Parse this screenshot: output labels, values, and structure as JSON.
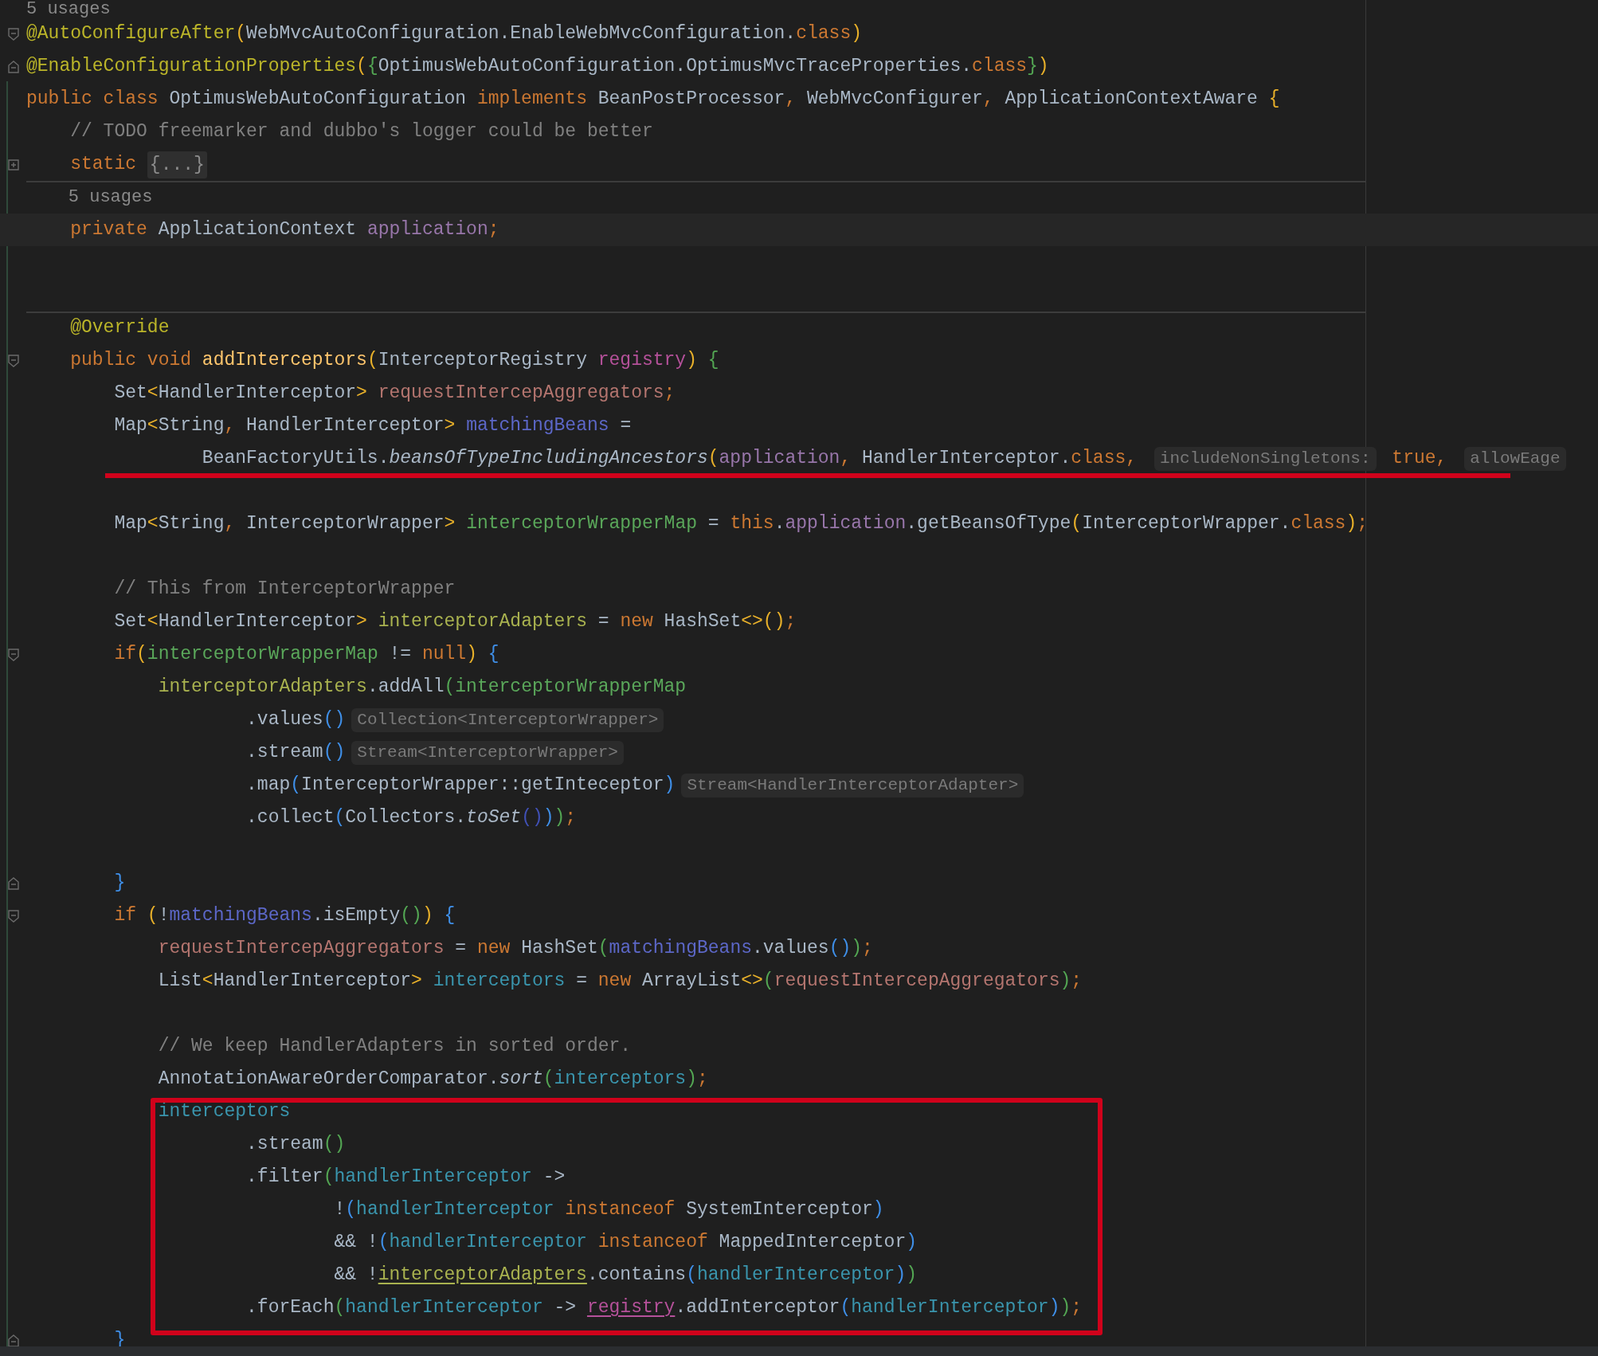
{
  "editor": {
    "lines": [
      {
        "kind": "code",
        "current": false,
        "tokens": [
          {
            "kind": "usages",
            "text": "5 usages"
          }
        ]
      },
      {
        "kind": "code",
        "current": false,
        "fold_marker": {
          "kind": "start"
        },
        "tokens": [
          {
            "kind": "annotation",
            "text": "@AutoConfigureAfter"
          },
          {
            "kind": "brace_yellow",
            "text": "("
          },
          {
            "kind": "plain",
            "text": "WebMvcAutoConfiguration.EnableWebMvcConfiguration."
          },
          {
            "kind": "keyword",
            "text": "class"
          },
          {
            "kind": "brace_yellow",
            "text": ")"
          }
        ]
      },
      {
        "kind": "code",
        "current": false,
        "fold_marker": {
          "kind": "end"
        },
        "tokens": [
          {
            "kind": "annotation",
            "text": "@EnableConfigurationProperties"
          },
          {
            "kind": "brace_yellow",
            "text": "("
          },
          {
            "kind": "brace_green",
            "text": "{"
          },
          {
            "kind": "plain",
            "text": "OptimusWebAutoConfiguration.OptimusMvcTraceProperties."
          },
          {
            "kind": "keyword",
            "text": "class"
          },
          {
            "kind": "brace_green",
            "text": "}"
          },
          {
            "kind": "brace_yellow",
            "text": ")"
          }
        ]
      },
      {
        "kind": "code",
        "current": false,
        "tokens": [
          {
            "kind": "keyword",
            "text": "public class "
          },
          {
            "kind": "plain",
            "text": "OptimusWebAutoConfiguration "
          },
          {
            "kind": "keyword",
            "text": "implements "
          },
          {
            "kind": "plain",
            "text": "BeanPostProcessor"
          },
          {
            "kind": "keyword",
            "text": ", "
          },
          {
            "kind": "plain",
            "text": "WebMvcConfigurer"
          },
          {
            "kind": "keyword",
            "text": ", "
          },
          {
            "kind": "plain",
            "text": "ApplicationContextAware "
          },
          {
            "kind": "brace_yellow",
            "text": "{"
          }
        ]
      },
      {
        "kind": "code",
        "current": false,
        "tokens": [
          {
            "kind": "comment",
            "text": "    // TODO freemarker and dubbo's logger could be better"
          }
        ]
      },
      {
        "kind": "code",
        "current": false,
        "fold_marker": {
          "kind": "collapsed"
        },
        "tokens": [
          {
            "kind": "keyword",
            "text": "    static "
          },
          {
            "kind": "folded",
            "text": "{...}"
          }
        ]
      },
      {
        "kind": "code",
        "current": false,
        "separator": true,
        "tokens": [
          {
            "kind": "usages",
            "text": "    5 usages"
          }
        ]
      },
      {
        "kind": "code",
        "current": true,
        "tokens": [
          {
            "kind": "keyword",
            "text": "    private "
          },
          {
            "kind": "plain",
            "text": "ApplicationContext "
          },
          {
            "kind": "field",
            "text": "application"
          },
          {
            "kind": "keyword",
            "text": ";"
          }
        ]
      },
      {
        "kind": "blank",
        "current": false
      },
      {
        "kind": "blank",
        "current": false
      },
      {
        "kind": "code",
        "current": false,
        "separator": true,
        "tokens": [
          {
            "kind": "annotation",
            "text": "    @Override"
          }
        ]
      },
      {
        "kind": "code",
        "current": false,
        "fold_marker": {
          "kind": "start"
        },
        "tokens": [
          {
            "kind": "keyword",
            "text": "    public void "
          },
          {
            "kind": "declaration",
            "text": "addInterceptors"
          },
          {
            "kind": "brace_yellow",
            "text": "("
          },
          {
            "kind": "plain",
            "text": "InterceptorRegistry "
          },
          {
            "kind": "parameter",
            "text": "registry"
          },
          {
            "kind": "brace_yellow",
            "text": ") "
          },
          {
            "kind": "brace_green",
            "text": "{"
          }
        ]
      },
      {
        "kind": "code",
        "current": false,
        "tokens": [
          {
            "kind": "plain",
            "text": "        Set"
          },
          {
            "kind": "brace_yellow",
            "text": "<"
          },
          {
            "kind": "plain",
            "text": "HandlerInterceptor"
          },
          {
            "kind": "brace_yellow",
            "text": "> "
          },
          {
            "kind": "var_red",
            "text": "requestIntercepAggregators"
          },
          {
            "kind": "keyword",
            "text": ";"
          }
        ]
      },
      {
        "kind": "code",
        "current": false,
        "tokens": [
          {
            "kind": "plain",
            "text": "        Map"
          },
          {
            "kind": "brace_yellow",
            "text": "<"
          },
          {
            "kind": "plain",
            "text": "String"
          },
          {
            "kind": "keyword",
            "text": ", "
          },
          {
            "kind": "plain",
            "text": "HandlerInterceptor"
          },
          {
            "kind": "brace_yellow",
            "text": "> "
          },
          {
            "kind": "var_blue",
            "text": "matchingBeans"
          },
          {
            "kind": "plain",
            "text": " ="
          }
        ]
      },
      {
        "kind": "code",
        "current": false,
        "tokens": [
          {
            "kind": "plain",
            "text": "                BeanFactoryUtils."
          },
          {
            "kind": "static_call",
            "text": "beansOfTypeIncludingAncestors"
          },
          {
            "kind": "brace_yellow",
            "text": "("
          },
          {
            "kind": "field",
            "text": "application"
          },
          {
            "kind": "keyword",
            "text": ", "
          },
          {
            "kind": "plain",
            "text": "HandlerInterceptor."
          },
          {
            "kind": "keyword",
            "text": "class"
          },
          {
            "kind": "keyword",
            "text": ", "
          },
          {
            "kind": "hint",
            "text": "includeNonSingletons:"
          },
          {
            "kind": "keyword",
            "text": " true"
          },
          {
            "kind": "keyword",
            "text": ", "
          },
          {
            "kind": "hint",
            "text": "allowEage"
          }
        ]
      },
      {
        "kind": "blank",
        "current": false,
        "underlined": true
      },
      {
        "kind": "code",
        "current": false,
        "tokens": [
          {
            "kind": "plain",
            "text": "        Map"
          },
          {
            "kind": "brace_yellow",
            "text": "<"
          },
          {
            "kind": "plain",
            "text": "String"
          },
          {
            "kind": "keyword",
            "text": ", "
          },
          {
            "kind": "plain",
            "text": "InterceptorWrapper"
          },
          {
            "kind": "brace_yellow",
            "text": "> "
          },
          {
            "kind": "var_green",
            "text": "interceptorWrapperMap"
          },
          {
            "kind": "plain",
            "text": " = "
          },
          {
            "kind": "keyword",
            "text": "this"
          },
          {
            "kind": "plain",
            "text": "."
          },
          {
            "kind": "field",
            "text": "application"
          },
          {
            "kind": "plain",
            "text": ".getBeansOfType"
          },
          {
            "kind": "brace_yellow",
            "text": "("
          },
          {
            "kind": "plain",
            "text": "InterceptorWrapper."
          },
          {
            "kind": "keyword",
            "text": "class"
          },
          {
            "kind": "brace_yellow",
            "text": ")"
          },
          {
            "kind": "keyword",
            "text": ";"
          }
        ]
      },
      {
        "kind": "blank",
        "current": false
      },
      {
        "kind": "code",
        "current": false,
        "tokens": [
          {
            "kind": "comment",
            "text": "        // This from InterceptorWrapper"
          }
        ]
      },
      {
        "kind": "code",
        "current": false,
        "tokens": [
          {
            "kind": "plain",
            "text": "        Set"
          },
          {
            "kind": "brace_yellow",
            "text": "<"
          },
          {
            "kind": "plain",
            "text": "HandlerInterceptor"
          },
          {
            "kind": "brace_yellow",
            "text": "> "
          },
          {
            "kind": "var_olive",
            "text": "interceptorAdapters"
          },
          {
            "kind": "plain",
            "text": " = "
          },
          {
            "kind": "keyword",
            "text": "new "
          },
          {
            "kind": "plain",
            "text": "HashSet"
          },
          {
            "kind": "brace_yellow",
            "text": "<>()"
          },
          {
            "kind": "keyword",
            "text": ";"
          }
        ]
      },
      {
        "kind": "code",
        "current": false,
        "fold_marker": {
          "kind": "start"
        },
        "tokens": [
          {
            "kind": "keyword",
            "text": "        if"
          },
          {
            "kind": "brace_yellow",
            "text": "("
          },
          {
            "kind": "var_green",
            "text": "interceptorWrapperMap"
          },
          {
            "kind": "plain",
            "text": " != "
          },
          {
            "kind": "keyword",
            "text": "null"
          },
          {
            "kind": "brace_yellow",
            "text": ") "
          },
          {
            "kind": "brace_blue",
            "text": "{"
          }
        ]
      },
      {
        "kind": "code",
        "current": false,
        "tokens": [
          {
            "kind": "var_olive",
            "text": "            interceptorAdapters"
          },
          {
            "kind": "plain",
            "text": ".addAll"
          },
          {
            "kind": "brace_green",
            "text": "("
          },
          {
            "kind": "var_green",
            "text": "interceptorWrapperMap"
          }
        ]
      },
      {
        "kind": "code",
        "current": false,
        "tokens": [
          {
            "kind": "plain",
            "text": "                    .values"
          },
          {
            "kind": "brace_blue",
            "text": "()"
          },
          {
            "kind": "hint",
            "text": "Collection<InterceptorWrapper>"
          }
        ]
      },
      {
        "kind": "code",
        "current": false,
        "tokens": [
          {
            "kind": "plain",
            "text": "                    .stream"
          },
          {
            "kind": "brace_blue",
            "text": "()"
          },
          {
            "kind": "hint",
            "text": "Stream<InterceptorWrapper>"
          }
        ]
      },
      {
        "kind": "code",
        "current": false,
        "tokens": [
          {
            "kind": "plain",
            "text": "                    .map"
          },
          {
            "kind": "brace_blue",
            "text": "("
          },
          {
            "kind": "plain",
            "text": "InterceptorWrapper::getInteceptor"
          },
          {
            "kind": "brace_blue",
            "text": ")"
          },
          {
            "kind": "hint",
            "text": "Stream<HandlerInterceptorAdapter>"
          }
        ]
      },
      {
        "kind": "code",
        "current": false,
        "tokens": [
          {
            "kind": "plain",
            "text": "                    .collect"
          },
          {
            "kind": "brace_blue",
            "text": "("
          },
          {
            "kind": "plain",
            "text": "Collectors."
          },
          {
            "kind": "static_call",
            "text": "toSet"
          },
          {
            "kind": "brace_indigo",
            "text": "()"
          },
          {
            "kind": "brace_blue",
            "text": ")"
          },
          {
            "kind": "brace_green",
            "text": ")"
          },
          {
            "kind": "keyword",
            "text": ";"
          }
        ]
      },
      {
        "kind": "blank",
        "current": false
      },
      {
        "kind": "code",
        "current": false,
        "fold_marker": {
          "kind": "end"
        },
        "tokens": [
          {
            "kind": "brace_blue",
            "text": "        }"
          }
        ]
      },
      {
        "kind": "code",
        "current": false,
        "fold_marker": {
          "kind": "start"
        },
        "tokens": [
          {
            "kind": "keyword",
            "text": "        if "
          },
          {
            "kind": "brace_yellow",
            "text": "("
          },
          {
            "kind": "plain",
            "text": "!"
          },
          {
            "kind": "var_blue",
            "text": "matchingBeans"
          },
          {
            "kind": "plain",
            "text": ".isEmpty"
          },
          {
            "kind": "brace_green",
            "text": "()"
          },
          {
            "kind": "brace_yellow",
            "text": ") "
          },
          {
            "kind": "brace_blue",
            "text": "{"
          }
        ]
      },
      {
        "kind": "code",
        "current": false,
        "tokens": [
          {
            "kind": "var_red",
            "text": "            requestIntercepAggregators"
          },
          {
            "kind": "plain",
            "text": " = "
          },
          {
            "kind": "keyword",
            "text": "new "
          },
          {
            "kind": "plain",
            "text": "HashSet"
          },
          {
            "kind": "brace_green",
            "text": "("
          },
          {
            "kind": "var_blue",
            "text": "matchingBeans"
          },
          {
            "kind": "plain",
            "text": ".values"
          },
          {
            "kind": "brace_blue",
            "text": "()"
          },
          {
            "kind": "brace_green",
            "text": ")"
          },
          {
            "kind": "keyword",
            "text": ";"
          }
        ]
      },
      {
        "kind": "code",
        "current": false,
        "tokens": [
          {
            "kind": "plain",
            "text": "            List"
          },
          {
            "kind": "brace_yellow",
            "text": "<"
          },
          {
            "kind": "plain",
            "text": "HandlerInterceptor"
          },
          {
            "kind": "brace_yellow",
            "text": "> "
          },
          {
            "kind": "var_teal",
            "text": "interceptors"
          },
          {
            "kind": "plain",
            "text": " = "
          },
          {
            "kind": "keyword",
            "text": "new "
          },
          {
            "kind": "plain",
            "text": "ArrayList"
          },
          {
            "kind": "brace_yellow",
            "text": "<>"
          },
          {
            "kind": "brace_green",
            "text": "("
          },
          {
            "kind": "var_red",
            "text": "requestIntercepAggregators"
          },
          {
            "kind": "brace_green",
            "text": ")"
          },
          {
            "kind": "keyword",
            "text": ";"
          }
        ]
      },
      {
        "kind": "blank",
        "current": false
      },
      {
        "kind": "code",
        "current": false,
        "tokens": [
          {
            "kind": "comment",
            "text": "            // We keep HandlerAdapters in sorted order."
          }
        ]
      },
      {
        "kind": "code",
        "current": false,
        "tokens": [
          {
            "kind": "plain",
            "text": "            AnnotationAwareOrderComparator."
          },
          {
            "kind": "static_call",
            "text": "sort"
          },
          {
            "kind": "brace_green",
            "text": "("
          },
          {
            "kind": "var_teal",
            "text": "interceptors"
          },
          {
            "kind": "brace_green",
            "text": ")"
          },
          {
            "kind": "keyword",
            "text": ";"
          }
        ]
      },
      {
        "kind": "code",
        "current": false,
        "tokens": [
          {
            "kind": "var_teal",
            "text": "            interceptors"
          }
        ]
      },
      {
        "kind": "code",
        "current": false,
        "tokens": [
          {
            "kind": "plain",
            "text": "                    .stream"
          },
          {
            "kind": "brace_green",
            "text": "()"
          }
        ]
      },
      {
        "kind": "code",
        "current": false,
        "tokens": [
          {
            "kind": "plain",
            "text": "                    .filter"
          },
          {
            "kind": "brace_green",
            "text": "("
          },
          {
            "kind": "var_teal",
            "text": "handlerInterceptor"
          },
          {
            "kind": "plain",
            "text": " ->"
          }
        ]
      },
      {
        "kind": "code",
        "current": false,
        "tokens": [
          {
            "kind": "plain",
            "text": "                            !"
          },
          {
            "kind": "brace_blue",
            "text": "("
          },
          {
            "kind": "var_teal",
            "text": "handlerInterceptor"
          },
          {
            "kind": "keyword",
            "text": " instanceof "
          },
          {
            "kind": "plain",
            "text": "SystemInterceptor"
          },
          {
            "kind": "brace_blue",
            "text": ")"
          }
        ]
      },
      {
        "kind": "code",
        "current": false,
        "tokens": [
          {
            "kind": "plain",
            "text": "                            && !"
          },
          {
            "kind": "brace_blue",
            "text": "("
          },
          {
            "kind": "var_teal",
            "text": "handlerInterceptor"
          },
          {
            "kind": "keyword",
            "text": " instanceof "
          },
          {
            "kind": "plain",
            "text": "MappedInterceptor"
          },
          {
            "kind": "brace_blue",
            "text": ")"
          }
        ]
      },
      {
        "kind": "code",
        "current": false,
        "tokens": [
          {
            "kind": "plain",
            "text": "                            && !"
          },
          {
            "kind": "var_olive",
            "underline": true,
            "text": "interceptorAdapters"
          },
          {
            "kind": "plain",
            "text": ".contains"
          },
          {
            "kind": "brace_blue",
            "text": "("
          },
          {
            "kind": "var_teal",
            "text": "handlerInterceptor"
          },
          {
            "kind": "brace_blue",
            "text": ")"
          },
          {
            "kind": "brace_green",
            "text": ")"
          }
        ]
      },
      {
        "kind": "code",
        "current": false,
        "tokens": [
          {
            "kind": "plain",
            "text": "                    .forEach"
          },
          {
            "kind": "brace_green",
            "text": "("
          },
          {
            "kind": "var_teal",
            "text": "handlerInterceptor"
          },
          {
            "kind": "plain",
            "text": " -> "
          },
          {
            "kind": "parameter",
            "underline": true,
            "text": "registry"
          },
          {
            "kind": "plain",
            "text": ".addInterceptor"
          },
          {
            "kind": "brace_blue",
            "text": "("
          },
          {
            "kind": "var_teal",
            "text": "handlerInterceptor"
          },
          {
            "kind": "brace_blue",
            "text": ")"
          },
          {
            "kind": "brace_green",
            "text": ")"
          },
          {
            "kind": "keyword",
            "text": ";"
          }
        ]
      },
      {
        "kind": "code",
        "current": false,
        "fold_marker": {
          "kind": "end"
        },
        "tokens": [
          {
            "kind": "brace_blue",
            "text": "        }"
          }
        ]
      }
    ]
  }
}
